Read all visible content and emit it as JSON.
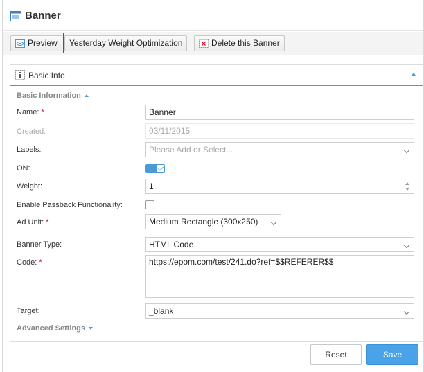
{
  "header": {
    "title": "Banner",
    "icon": "banner-icon"
  },
  "toolbar": {
    "preview_label": "Preview",
    "optimization_label": "Yesterday Weight Optimization",
    "delete_label": "Delete this Banner"
  },
  "panel": {
    "title": "Basic Info",
    "section_basic": "Basic Information",
    "section_advanced": "Advanced Settings"
  },
  "form": {
    "name": {
      "label": "Name:",
      "required": "*",
      "value": "Banner"
    },
    "created": {
      "label": "Created:",
      "value": "03/11/2015"
    },
    "labels": {
      "label": "Labels:",
      "placeholder": "Please Add or Select..."
    },
    "on": {
      "label": "ON:",
      "checked": true
    },
    "weight": {
      "label": "Weight:",
      "value": "1"
    },
    "passback": {
      "label": "Enable Passback Functionality:",
      "checked": false
    },
    "ad_unit": {
      "label": "Ad Unit:",
      "required": "*",
      "value": "Medium Rectangle (300x250)"
    },
    "banner_type": {
      "label": "Banner Type:",
      "value": "HTML Code"
    },
    "code": {
      "label": "Code:",
      "required": "*",
      "value": "https://epom.com/test/241.do?ref=$$REFERER$$"
    },
    "target": {
      "label": "Target:",
      "value": "_blank"
    }
  },
  "actions": {
    "reset_label": "Reset",
    "save_label": "Save"
  },
  "colors": {
    "accent": "#4a9ad6",
    "save": "#4aa3e8",
    "required": "#d0202a",
    "highlight": "#d0202a"
  }
}
